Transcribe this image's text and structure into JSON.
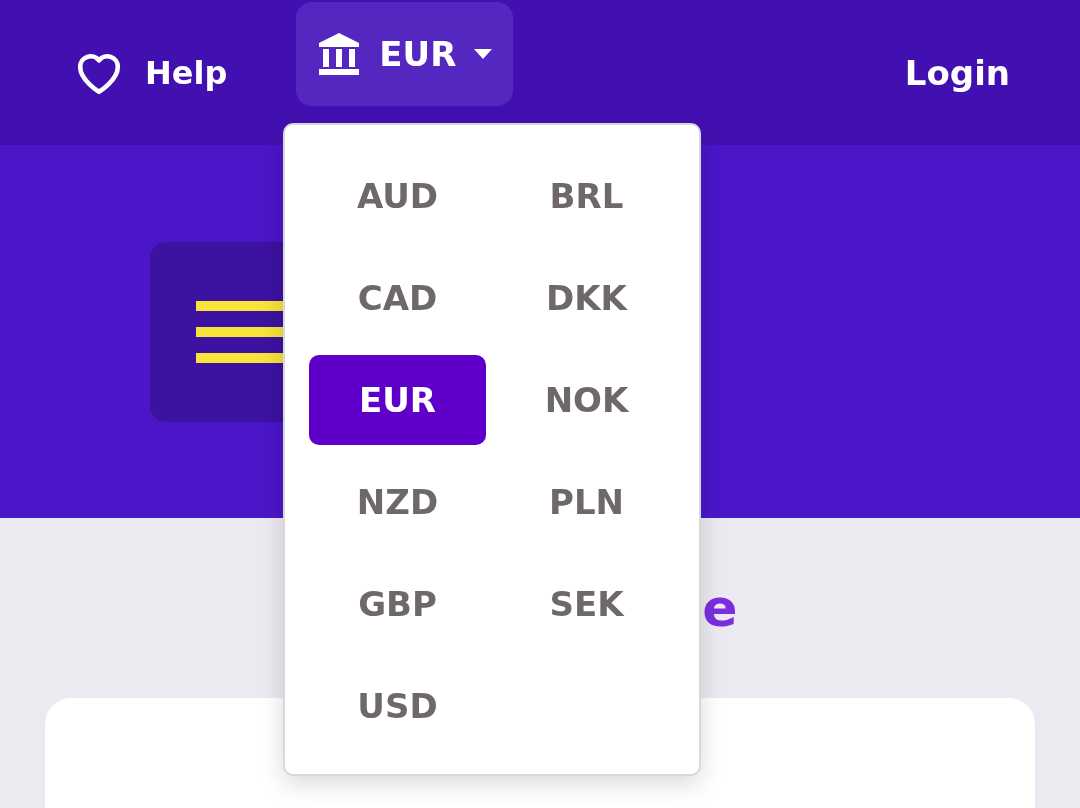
{
  "nav": {
    "help": "Help",
    "currency": "EUR",
    "login": "Login"
  },
  "currency_menu": [
    {
      "code": "AUD",
      "selected": false
    },
    {
      "code": "BRL",
      "selected": false
    },
    {
      "code": "CAD",
      "selected": false
    },
    {
      "code": "DKK",
      "selected": false
    },
    {
      "code": "EUR",
      "selected": true
    },
    {
      "code": "NOK",
      "selected": false
    },
    {
      "code": "NZD",
      "selected": false
    },
    {
      "code": "PLN",
      "selected": false
    },
    {
      "code": "GBP",
      "selected": false
    },
    {
      "code": "SEK",
      "selected": false
    },
    {
      "code": "USD",
      "selected": false
    }
  ],
  "heading_fragment": "e"
}
